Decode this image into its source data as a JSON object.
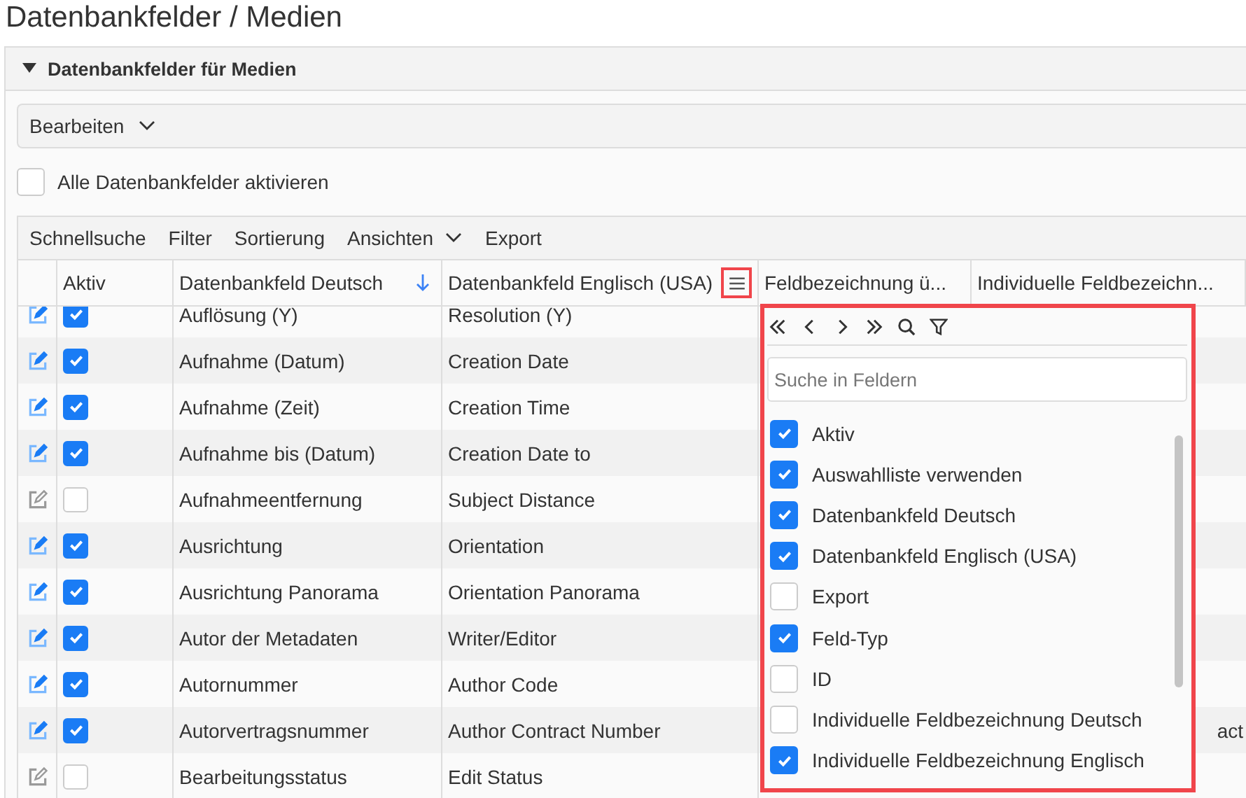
{
  "title": "Datenbankfelder / Medien",
  "panel": {
    "title": "Datenbankfelder für Medien",
    "expanded": true
  },
  "edit_menu": {
    "label": "Bearbeiten"
  },
  "select_all": {
    "label": "Alle Datenbankfelder aktivieren",
    "checked": false
  },
  "toolbar": [
    {
      "label": "Schnellsuche",
      "kind": "plain"
    },
    {
      "label": "Filter",
      "kind": "plain"
    },
    {
      "label": "Sortierung",
      "kind": "plain"
    },
    {
      "label": "Ansichten",
      "kind": "dropdown"
    },
    {
      "label": "Export",
      "kind": "plain"
    }
  ],
  "table": {
    "columns": [
      {
        "label": "Aktiv",
        "sorted": false,
        "menu_open": false
      },
      {
        "label": "Datenbankfeld Deutsch",
        "sorted": true,
        "menu_open": false
      },
      {
        "label": "Datenbankfeld Englisch (USA)",
        "sorted": false,
        "menu_open": true
      },
      {
        "label": "Feldbezeichnung ü...",
        "sorted": false,
        "menu_open": false
      },
      {
        "label": "Individuelle Feldbezeichn...",
        "sorted": false,
        "menu_open": false
      }
    ],
    "rows": [
      {
        "active": true,
        "deutsch": "Auflösung (Y)",
        "englisch": "Resolution (Y)"
      },
      {
        "active": true,
        "deutsch": "Aufnahme (Datum)",
        "englisch": "Creation Date"
      },
      {
        "active": true,
        "deutsch": "Aufnahme (Zeit)",
        "englisch": "Creation Time"
      },
      {
        "active": true,
        "deutsch": "Aufnahme bis (Datum)",
        "englisch": "Creation Date to"
      },
      {
        "active": false,
        "deutsch": "Aufnahmeentfernung",
        "englisch": "Subject Distance"
      },
      {
        "active": true,
        "deutsch": "Ausrichtung",
        "englisch": "Orientation"
      },
      {
        "active": true,
        "deutsch": "Ausrichtung Panorama",
        "englisch": "Orientation Panorama"
      },
      {
        "active": true,
        "deutsch": "Autor der Metadaten",
        "englisch": "Writer/Editor"
      },
      {
        "active": true,
        "deutsch": "Autornummer",
        "englisch": "Author Code"
      },
      {
        "active": true,
        "deutsch": "Autorvertragsnummer",
        "englisch": "Author Contract Number",
        "column_6": "act"
      },
      {
        "active": false,
        "deutsch": "Bearbeitungsstatus",
        "englisch": "Edit Status"
      }
    ]
  },
  "column_menu": {
    "search": {
      "placeholder": "Suche in Feldern"
    },
    "items": [
      {
        "label": "Aktiv",
        "checked": true
      },
      {
        "label": "Auswahlliste verwenden",
        "checked": true
      },
      {
        "label": "Datenbankfeld Deutsch",
        "checked": true
      },
      {
        "label": "Datenbankfeld Englisch (USA)",
        "checked": true
      },
      {
        "label": "Export",
        "checked": false
      },
      {
        "label": "Feld-Typ",
        "checked": true
      },
      {
        "label": "ID",
        "checked": false
      },
      {
        "label": "Individuelle Feldbezeichnung Deutsch",
        "checked": false
      },
      {
        "label": "Individuelle Feldbezeichnung Englisch",
        "checked": true
      }
    ]
  }
}
